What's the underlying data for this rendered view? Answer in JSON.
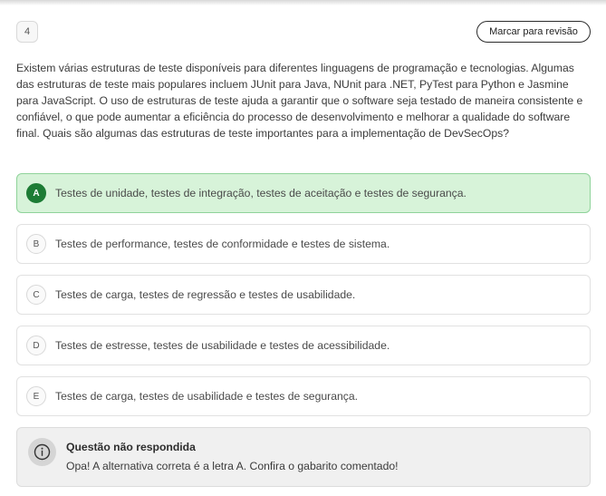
{
  "header": {
    "question_number": "4",
    "review_button_label": "Marcar para revisão"
  },
  "question": {
    "text": "Existem várias estruturas de teste disponíveis para diferentes linguagens de programação e tecnologias. Algumas das estruturas de teste mais populares incluem JUnit para Java, NUnit para .NET, PyTest para Python e Jasmine para JavaScript. O uso de estruturas de teste ajuda a garantir que o software seja testado de maneira consistente e confiável, o que pode aumentar a eficiência do processo de desenvolvimento e melhorar a qualidade do software final. Quais são algumas das estruturas de teste importantes para a implementação de DevSecOps?"
  },
  "options": [
    {
      "letter": "A",
      "text": "Testes de unidade, testes de integração, testes de aceitação e testes de segurança.",
      "correct": true
    },
    {
      "letter": "B",
      "text": "Testes de performance, testes de conformidade e testes de sistema.",
      "correct": false
    },
    {
      "letter": "C",
      "text": "Testes de carga, testes de regressão e testes de usabilidade.",
      "correct": false
    },
    {
      "letter": "D",
      "text": "Testes de estresse, testes de usabilidade e testes de acessibilidade.",
      "correct": false
    },
    {
      "letter": "E",
      "text": "Testes de carga, testes de usabilidade e testes de segurança.",
      "correct": false
    }
  ],
  "feedback": {
    "icon": "info-icon",
    "title": "Questão não respondida",
    "message": "Opa! A alternativa correta é a letra A. Confira o gabarito comentado!"
  },
  "colors": {
    "correct_background": "#d7f3d9",
    "correct_border": "#8fd39a",
    "correct_badge": "#1d7c35"
  }
}
